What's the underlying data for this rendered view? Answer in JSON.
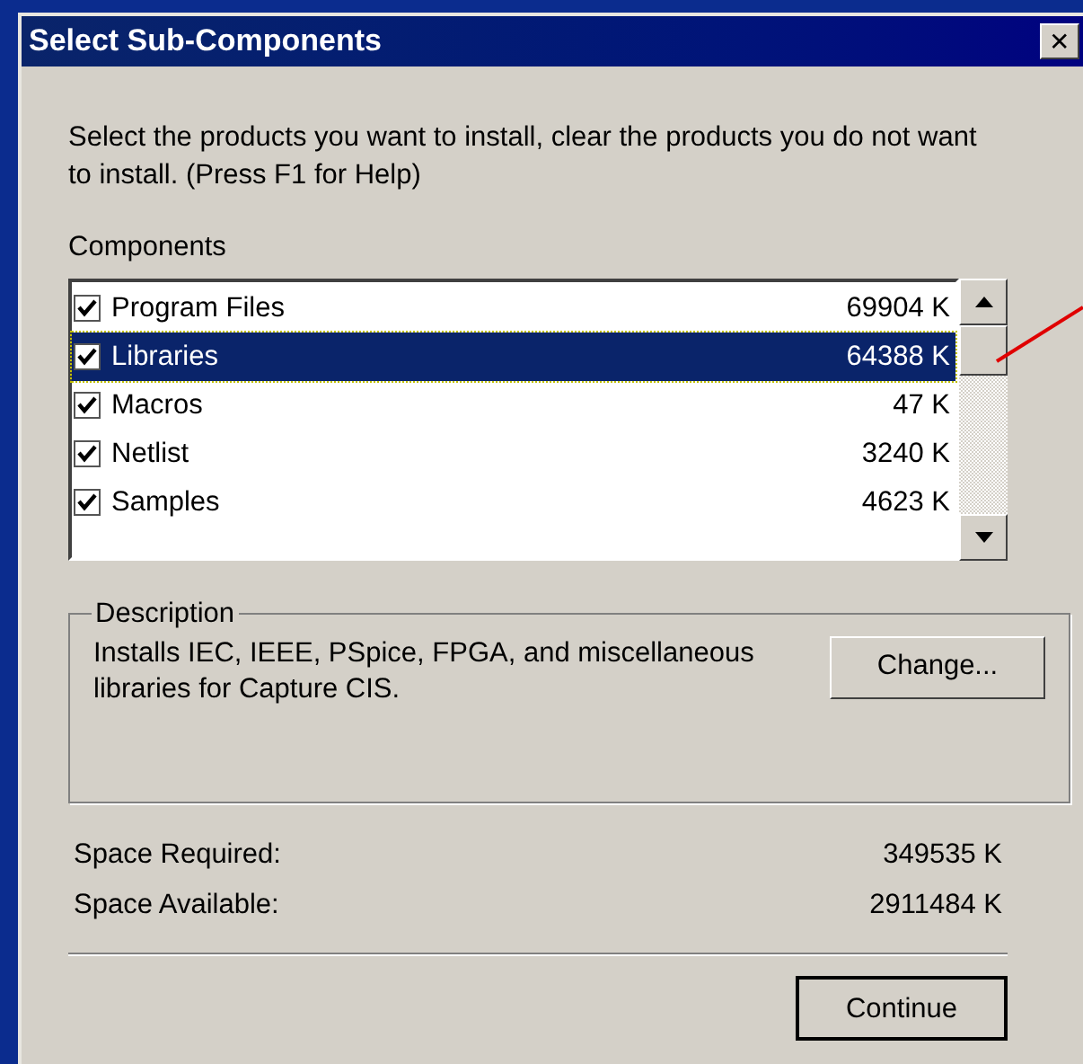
{
  "window": {
    "title": "Select Sub-Components",
    "close": "✕"
  },
  "instructions": "Select the products you want to install, clear the products you do not want to install. (Press F1 for Help)",
  "components_label": "Components",
  "components": [
    {
      "name": "Program Files",
      "size": "69904 K",
      "checked": true,
      "selected": false
    },
    {
      "name": "Libraries",
      "size": "64388 K",
      "checked": true,
      "selected": true
    },
    {
      "name": "Macros",
      "size": "47 K",
      "checked": true,
      "selected": false
    },
    {
      "name": "Netlist",
      "size": "3240 K",
      "checked": true,
      "selected": false
    },
    {
      "name": "Samples",
      "size": "4623 K",
      "checked": true,
      "selected": false
    }
  ],
  "description": {
    "label": "Description",
    "text": "Installs IEC, IEEE, PSpice, FPGA, and miscellaneous libraries for Capture CIS.",
    "button": "Change..."
  },
  "space": [
    {
      "label": "Space Required:",
      "value": "349535 K"
    },
    {
      "label": "Space Available:",
      "value": "2911484 K"
    }
  ],
  "buttons": [
    "Continue"
  ]
}
